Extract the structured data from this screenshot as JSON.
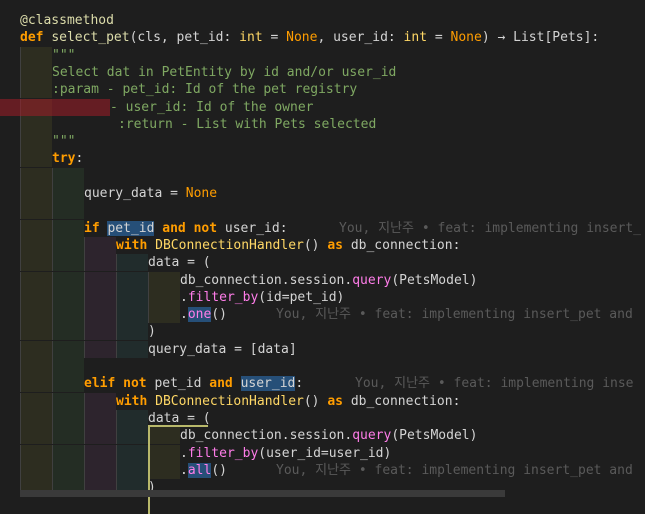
{
  "editor": {
    "lines": [
      {
        "id": "l1",
        "tokens": [
          {
            "t": "@classmethod",
            "c": "t-dec"
          }
        ]
      },
      {
        "id": "l2",
        "tokens": [
          {
            "t": "def",
            "c": "t-kw"
          },
          {
            "t": " ",
            "c": "t-plain"
          },
          {
            "t": "select_pet",
            "c": "t-fn"
          },
          {
            "t": "(cls, pet_id: ",
            "c": "t-plain"
          },
          {
            "t": "int",
            "c": "t-type"
          },
          {
            "t": " = ",
            "c": "t-plain"
          },
          {
            "t": "None",
            "c": "t-const"
          },
          {
            "t": ", user_id: ",
            "c": "t-plain"
          },
          {
            "t": "int",
            "c": "t-type"
          },
          {
            "t": " = ",
            "c": "t-plain"
          },
          {
            "t": "None",
            "c": "t-const"
          },
          {
            "t": ") → ",
            "c": "t-plain"
          },
          {
            "t": "List[Pets]:",
            "c": "t-plain"
          }
        ]
      },
      {
        "id": "l3",
        "tokens": [
          {
            "t": "\"\"\"",
            "c": "t-doc"
          }
        ]
      },
      {
        "id": "l4",
        "tokens": [
          {
            "t": "Select dat in PetEntity by id and/or user_id",
            "c": "t-doc"
          }
        ]
      },
      {
        "id": "l5",
        "tokens": [
          {
            "t": ":param - pet_id: Id of the pet registry",
            "c": "t-doc"
          }
        ]
      },
      {
        "id": "l6",
        "tokens": [
          {
            "t": "- user_id: Id of the owner",
            "c": "t-doc"
          }
        ]
      },
      {
        "id": "l7",
        "tokens": [
          {
            "t": ":return - List with Pets selected",
            "c": "t-doc"
          }
        ]
      },
      {
        "id": "l8",
        "tokens": [
          {
            "t": "\"\"\"",
            "c": "t-doc"
          }
        ]
      },
      {
        "id": "l9",
        "tokens": [
          {
            "t": "try",
            "c": "t-kw"
          },
          {
            "t": ":",
            "c": "t-plain"
          }
        ]
      },
      {
        "id": "l10",
        "tokens": []
      },
      {
        "id": "l11",
        "tokens": [
          {
            "t": "query_data = ",
            "c": "t-plain"
          },
          {
            "t": "None",
            "c": "t-const"
          }
        ]
      },
      {
        "id": "l12",
        "tokens": []
      },
      {
        "id": "l13",
        "tokens": [
          {
            "t": "if",
            "c": "t-kw"
          },
          {
            "t": " ",
            "c": "t-plain"
          },
          {
            "t": "pet_id",
            "c": "t-plain t-hl"
          },
          {
            "t": " ",
            "c": "t-plain"
          },
          {
            "t": "and not",
            "c": "t-kw"
          },
          {
            "t": " user_id:",
            "c": "t-plain"
          }
        ],
        "blame": "You, 지난주 • feat: implementing insert_"
      },
      {
        "id": "l14",
        "tokens": [
          {
            "t": "with",
            "c": "t-kw"
          },
          {
            "t": " ",
            "c": "t-plain"
          },
          {
            "t": "DBConnectionHandler",
            "c": "t-cls"
          },
          {
            "t": "() ",
            "c": "t-plain"
          },
          {
            "t": "as",
            "c": "t-kw"
          },
          {
            "t": " db_connection:",
            "c": "t-plain"
          }
        ]
      },
      {
        "id": "l15",
        "tokens": [
          {
            "t": "data = (",
            "c": "t-plain"
          }
        ]
      },
      {
        "id": "l16",
        "tokens": [
          {
            "t": "db_connection.session.",
            "c": "t-plain"
          },
          {
            "t": "query",
            "c": "t-method"
          },
          {
            "t": "(PetsModel)",
            "c": "t-plain"
          }
        ]
      },
      {
        "id": "l17",
        "tokens": [
          {
            "t": ".",
            "c": "t-plain"
          },
          {
            "t": "filter_by",
            "c": "t-method"
          },
          {
            "t": "(id=pet_id)",
            "c": "t-plain"
          }
        ]
      },
      {
        "id": "l18",
        "tokens": [
          {
            "t": ".",
            "c": "t-plain"
          },
          {
            "t": "one",
            "c": "t-method t-hl"
          },
          {
            "t": "()",
            "c": "t-plain"
          }
        ],
        "blame": "You, 지난주 • feat: implementing insert_pet and"
      },
      {
        "id": "l19",
        "tokens": [
          {
            "t": ")",
            "c": "t-plain"
          }
        ]
      },
      {
        "id": "l20",
        "tokens": [
          {
            "t": "query_data = [data]",
            "c": "t-plain"
          }
        ]
      },
      {
        "id": "l21",
        "tokens": []
      },
      {
        "id": "l22",
        "tokens": [
          {
            "t": "elif",
            "c": "t-kw"
          },
          {
            "t": " ",
            "c": "t-plain"
          },
          {
            "t": "not",
            "c": "t-kw"
          },
          {
            "t": " pet_id ",
            "c": "t-plain"
          },
          {
            "t": "and",
            "c": "t-kw"
          },
          {
            "t": " ",
            "c": "t-plain"
          },
          {
            "t": "user_id",
            "c": "t-plain t-hl"
          },
          {
            "t": ":",
            "c": "t-plain"
          }
        ],
        "blame": "You, 지난주 • feat: implementing inse"
      },
      {
        "id": "l23",
        "tokens": [
          {
            "t": "with",
            "c": "t-kw"
          },
          {
            "t": " ",
            "c": "t-plain"
          },
          {
            "t": "DBConnectionHandler",
            "c": "t-cls"
          },
          {
            "t": "() ",
            "c": "t-plain"
          },
          {
            "t": "as",
            "c": "t-kw"
          },
          {
            "t": " db_connection:",
            "c": "t-plain"
          }
        ]
      },
      {
        "id": "l24",
        "tokens": [
          {
            "t": "data = (",
            "c": "t-plain"
          }
        ]
      },
      {
        "id": "l25",
        "tokens": [
          {
            "t": "db_connection.session.",
            "c": "t-plain"
          },
          {
            "t": "query",
            "c": "t-method"
          },
          {
            "t": "(PetsModel)",
            "c": "t-plain"
          }
        ]
      },
      {
        "id": "l26",
        "tokens": [
          {
            "t": ".",
            "c": "t-plain"
          },
          {
            "t": "filter_by",
            "c": "t-method"
          },
          {
            "t": "(user_id=user_id)",
            "c": "t-plain"
          }
        ]
      },
      {
        "id": "l27",
        "tokens": [
          {
            "t": ".",
            "c": "t-plain"
          },
          {
            "t": "all",
            "c": "t-method t-hl"
          },
          {
            "t": "()",
            "c": "t-plain"
          }
        ],
        "blame": "You, 지난주 • feat: implementing insert_pet and"
      },
      {
        "id": "l28",
        "tokens": [
          {
            "t": ")",
            "c": "t-plain"
          }
        ]
      }
    ]
  }
}
